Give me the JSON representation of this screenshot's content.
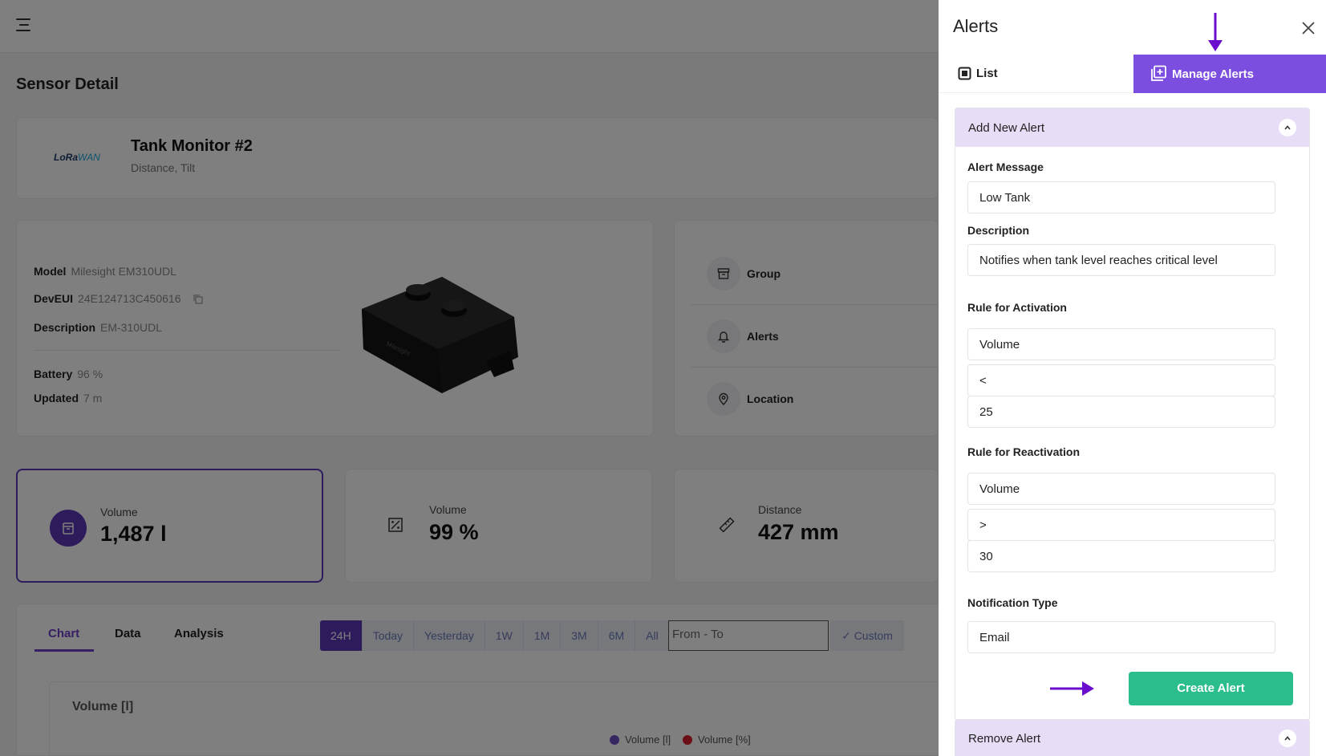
{
  "page": {
    "title": "Sensor Detail",
    "sensor": {
      "logo_main": "LoRa",
      "logo_accent": "WAN",
      "name": "Tank Monitor #2",
      "types": "Distance, Tilt"
    },
    "info": {
      "model_label": "Model",
      "model_value": "Milesight EM310UDL",
      "deveui_label": "DevEUI",
      "deveui_value": "24E124713C450616",
      "description_label": "Description",
      "description_value": "EM-310UDL",
      "battery_label": "Battery",
      "battery_value": "96 %",
      "updated_label": "Updated",
      "updated_value": "7 m"
    },
    "side_items": [
      {
        "label": "Group",
        "icon": "archive-icon"
      },
      {
        "label": "Alerts",
        "icon": "bell-icon"
      },
      {
        "label": "Location",
        "icon": "map-pin-icon"
      }
    ],
    "metrics": [
      {
        "label": "Volume",
        "value": "1,487 l",
        "icon": "tank-icon"
      },
      {
        "label": "Volume",
        "value": "99 %",
        "icon": "percent-icon"
      },
      {
        "label": "Distance",
        "value": "427 mm",
        "icon": "ruler-icon"
      }
    ],
    "tabs": [
      "Chart",
      "Data",
      "Analysis"
    ],
    "ranges": [
      "24H",
      "Today",
      "Yesterday",
      "1W",
      "1M",
      "3M",
      "6M",
      "All"
    ],
    "date_placeholder": "From - To",
    "custom_label": "Custom",
    "chart": {
      "title": "Volume [l]",
      "legend": [
        "Volume [l]",
        "Volume [%]"
      ]
    }
  },
  "panel": {
    "title": "Alerts",
    "tab_list": "List",
    "tab_manage": "Manage Alerts",
    "add_section": {
      "title": "Add New Alert",
      "alert_message_label": "Alert Message",
      "alert_message_value": "Low Tank",
      "description_label": "Description",
      "description_value": "Notifies when tank level reaches critical level",
      "activation_label": "Rule for Activation",
      "activation_metric": "Volume",
      "activation_operator": "<",
      "activation_value": "25",
      "reactivation_label": "Rule for Reactivation",
      "reactivation_metric": "Volume",
      "reactivation_operator": ">",
      "reactivation_value": "30",
      "notification_label": "Notification Type",
      "notification_value": "Email",
      "create_button": "Create Alert"
    },
    "remove_section": {
      "title": "Remove Alert"
    }
  },
  "colors": {
    "accent": "#7c4ee0",
    "primary_dark": "#5b36b8",
    "success": "#2bbd8c",
    "section_bg": "#e7ddf7",
    "arrow": "#6a0dcc"
  }
}
